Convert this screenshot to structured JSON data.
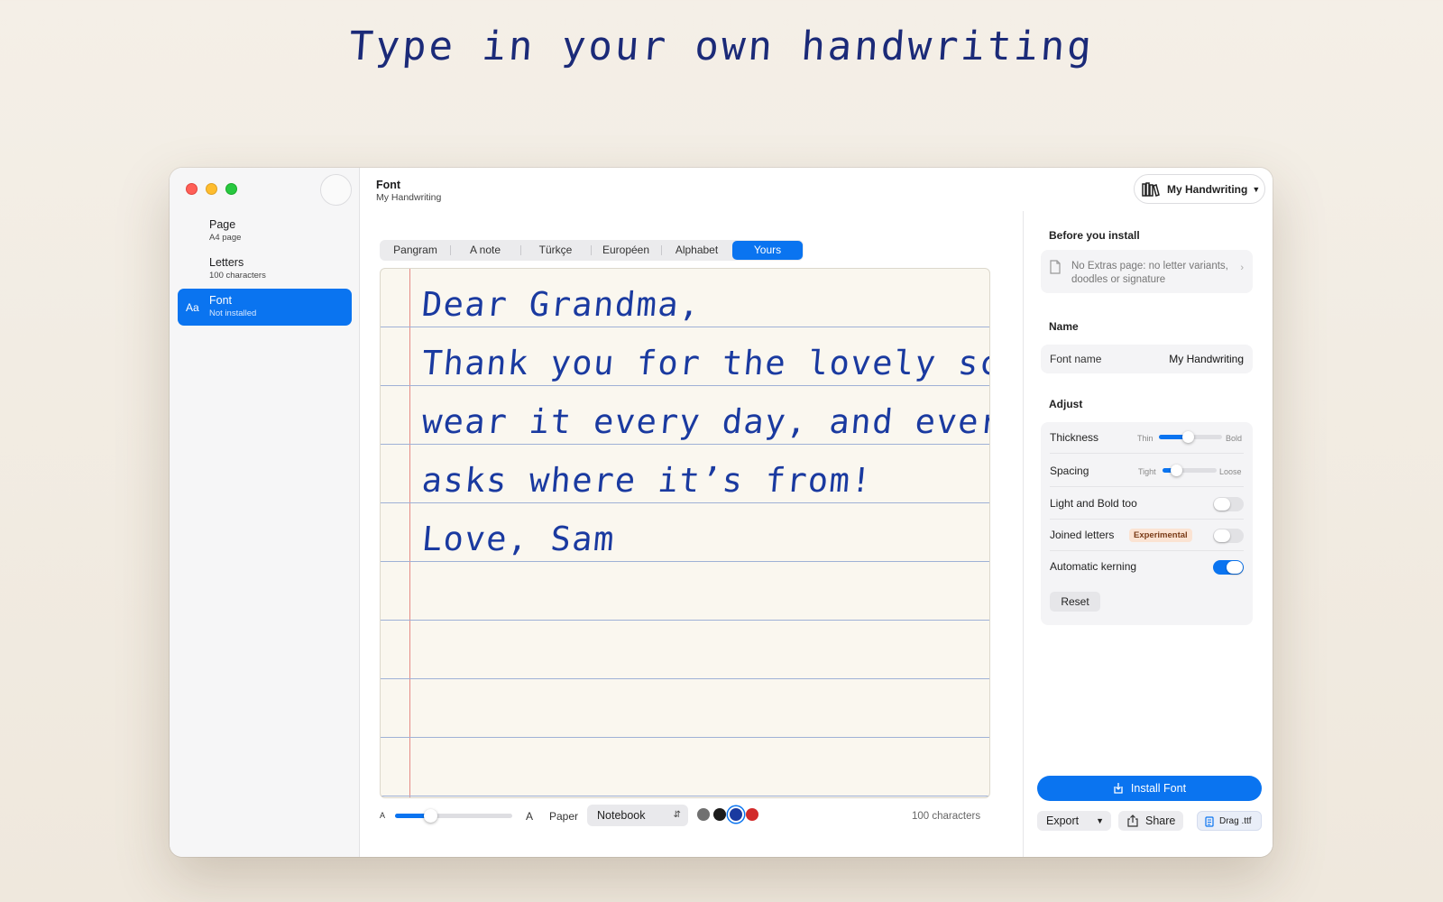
{
  "headline": "Type in your own handwriting",
  "sidebar": {
    "items": [
      {
        "label": "Page",
        "sub": "A4 page"
      },
      {
        "label": "Letters",
        "sub": "100 characters"
      },
      {
        "label": "Font",
        "sub": "Not installed",
        "icon_text": "Aa"
      }
    ]
  },
  "header": {
    "title": "Font",
    "subtitle": "My Handwriting",
    "library_button": "My Handwriting"
  },
  "tabs": [
    "Pangram",
    "A note",
    "Türkçe",
    "Européen",
    "Alphabet",
    "Yours"
  ],
  "active_tab": "Yours",
  "document": {
    "lines": [
      "Dear Grandma,",
      "Thank you for the lovely scarf. I",
      "wear it every day, and everyone",
      "asks where it’s from!",
      "Love, Sam"
    ]
  },
  "toolbar": {
    "size_small": "A",
    "size_large": "A",
    "size_level": 0.3,
    "paper_label": "Paper",
    "paper_value": "Notebook",
    "ink_colors": [
      "#707070",
      "#1c1c1c",
      "#1a3aa0",
      "#d22a2a"
    ],
    "selected_ink": 2,
    "char_count": "100 characters"
  },
  "panel": {
    "before_title": "Before you install",
    "notice": "No Extras page: no letter variants, doodles or signature",
    "name_title": "Name",
    "font_name_label": "Font name",
    "font_name_value": "My Handwriting",
    "adjust_title": "Adjust",
    "thickness": {
      "label": "Thickness",
      "min": "Thin",
      "max": "Bold",
      "level": 0.45
    },
    "spacing": {
      "label": "Spacing",
      "min": "Tight",
      "max": "Loose",
      "level": 0.25
    },
    "light_bold": {
      "label": "Light and Bold too",
      "on": false
    },
    "joined": {
      "label": "Joined letters",
      "badge": "Experimental",
      "on": false
    },
    "kerning": {
      "label": "Automatic kerning",
      "on": true
    },
    "reset": "Reset",
    "install": "Install Font",
    "export": "Export",
    "share": "Share",
    "drag": "Drag .ttf"
  },
  "colors": {
    "accent": "#0a74f0",
    "ink": "#1a3aa0"
  }
}
